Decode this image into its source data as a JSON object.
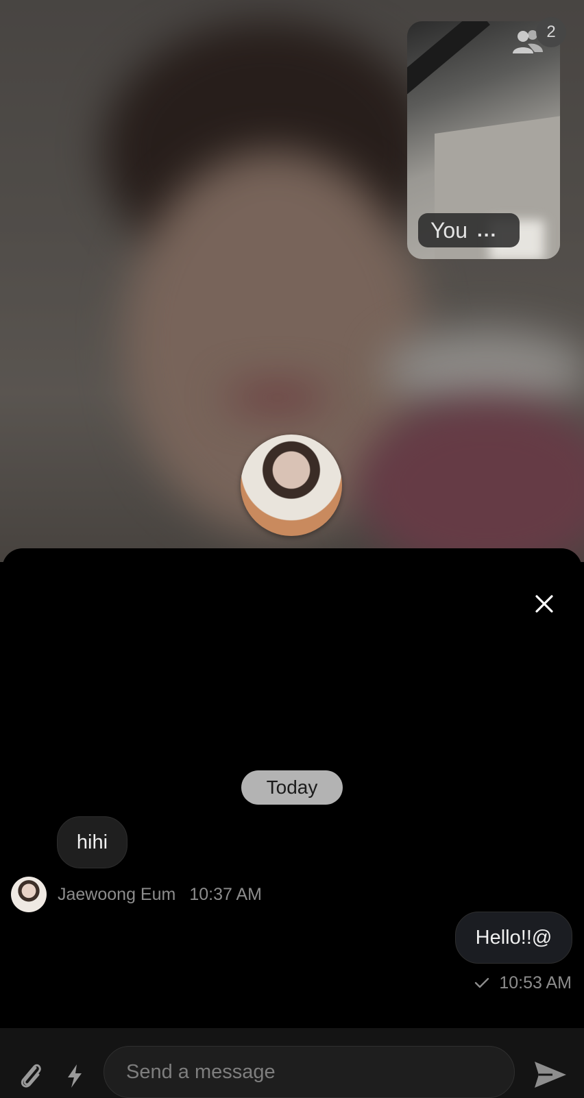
{
  "call": {
    "participants_count": "2",
    "self_label": "You",
    "self_menu": "..."
  },
  "chat": {
    "date_divider": "Today",
    "messages": [
      {
        "direction": "incoming",
        "text": "hihi",
        "sender": "Jaewoong Eum",
        "time": "10:37 AM"
      },
      {
        "direction": "outgoing",
        "text": "Hello!!@",
        "time": "10:53 AM",
        "status": "sent"
      }
    ]
  },
  "composer": {
    "placeholder": "Send a message"
  },
  "colors": {
    "panel_bg": "#000000",
    "bubble_bg": "#1f1f1f",
    "date_chip_bg": "#b3b3b3",
    "meta_text": "#8c8c8c"
  },
  "icons": {
    "close": "close-icon",
    "participants": "people-icon",
    "attach": "paperclip-icon",
    "commands": "lightning-icon",
    "send": "send-icon",
    "read_receipt": "check-icon"
  }
}
